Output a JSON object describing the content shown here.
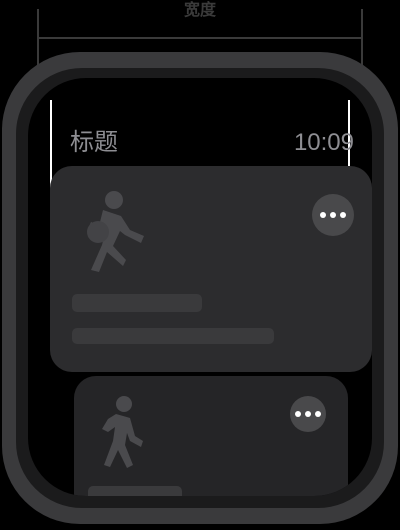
{
  "overlay": {
    "width_label": "宽度"
  },
  "header": {
    "title": "标题",
    "time": "10:09"
  },
  "cards": [
    {
      "icon": "running-figure-icon",
      "more_button": "ellipsis-more-button"
    },
    {
      "icon": "walking-figure-icon",
      "more_button": "ellipsis-more-button"
    }
  ],
  "colors": {
    "background": "#000000",
    "card": "#2c2c2e",
    "card_secondary": "#252527",
    "placeholder": "#3a3a3c",
    "more_button": "#49494b",
    "header_text": "#8e8e93",
    "icon": "#4a4a4d"
  }
}
